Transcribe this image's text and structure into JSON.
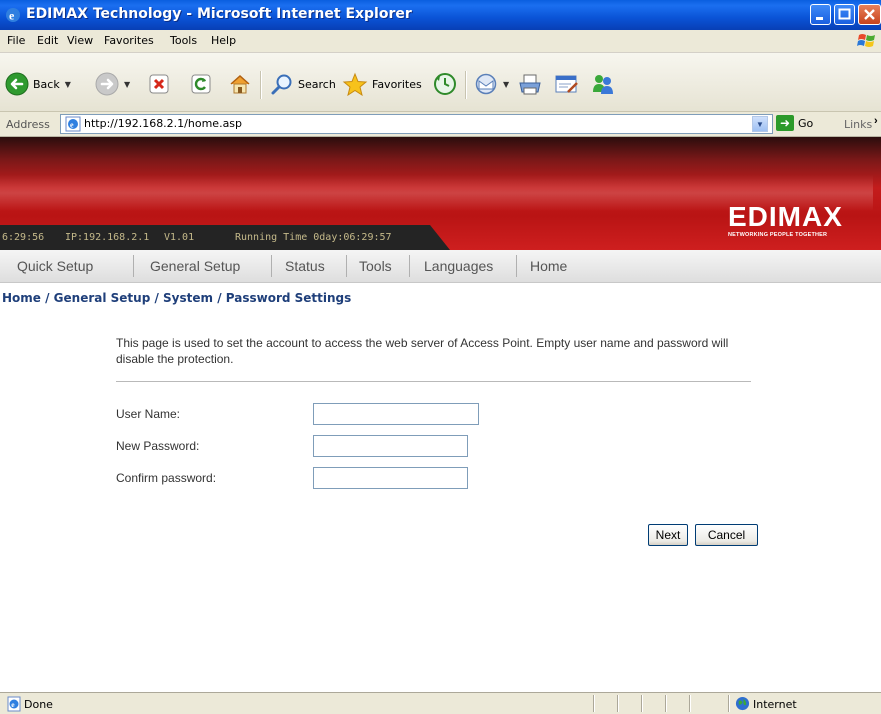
{
  "window": {
    "title": "EDIMAX Technology - Microsoft Internet Explorer"
  },
  "menu": [
    "File",
    "Edit",
    "View",
    "Favorites",
    "Tools",
    "Help"
  ],
  "toolbar": {
    "back": "Back",
    "search": "Search",
    "favorites": "Favorites"
  },
  "address": {
    "label": "Address",
    "url": "http://192.168.2.1/home.asp",
    "go": "Go",
    "links": "Links"
  },
  "banner": {
    "clock": "6:29:56",
    "ip": "IP:192.168.2.1",
    "version": "V1.01",
    "running": "Running Time 0day:06:29:57",
    "logo_text": "EDIMAX",
    "logo_tagline": "NETWORKING PEOPLE TOGETHER"
  },
  "nav": [
    "Quick Setup",
    "General Setup",
    "Status",
    "Tools",
    "Languages",
    "Home"
  ],
  "page": {
    "breadcrumb": "Home / General Setup / System / Password Settings",
    "description": "This page is used to set the account to access the web server of Access Point. Empty user name and password will disable the protection.",
    "fields": [
      {
        "label": "User Name:",
        "value": ""
      },
      {
        "label": "New Password:",
        "value": ""
      },
      {
        "label": "Confirm password:",
        "value": ""
      }
    ],
    "next": "Next",
    "cancel": "Cancel"
  },
  "status": {
    "left": "Done",
    "zone": "Internet"
  }
}
